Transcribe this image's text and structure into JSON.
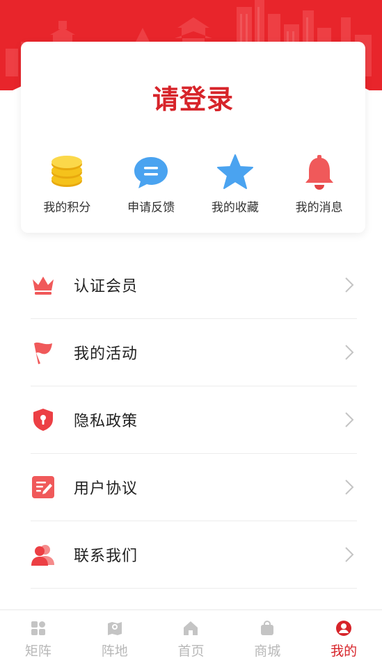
{
  "login": {
    "title": "请登录"
  },
  "quick_actions": [
    {
      "label": "我的积分",
      "icon": "coins-icon"
    },
    {
      "label": "申请反馈",
      "icon": "chat-bubble-icon"
    },
    {
      "label": "我的收藏",
      "icon": "star-icon"
    },
    {
      "label": "我的消息",
      "icon": "bell-icon"
    }
  ],
  "menu": [
    {
      "label": "认证会员",
      "icon": "crown-icon"
    },
    {
      "label": "我的活动",
      "icon": "flag-icon"
    },
    {
      "label": "隐私政策",
      "icon": "shield-icon"
    },
    {
      "label": "用户协议",
      "icon": "document-edit-icon"
    },
    {
      "label": "联系我们",
      "icon": "contacts-icon"
    }
  ],
  "tabbar": [
    {
      "label": "矩阵",
      "icon": "grid-icon",
      "active": false
    },
    {
      "label": "阵地",
      "icon": "map-pin-icon",
      "active": false
    },
    {
      "label": "首页",
      "icon": "home-icon",
      "active": false
    },
    {
      "label": "商城",
      "icon": "shopping-bag-icon",
      "active": false
    },
    {
      "label": "我的",
      "icon": "user-icon",
      "active": true
    }
  ],
  "colors": {
    "brand_red": "#e8252b",
    "title_red": "#d7242a",
    "coin_yellow": "#f5c21b",
    "chat_blue": "#4aa3f0",
    "star_blue": "#4aa3f0",
    "bell_red": "#f0595a",
    "inactive_tab": "#b8b8b8"
  }
}
